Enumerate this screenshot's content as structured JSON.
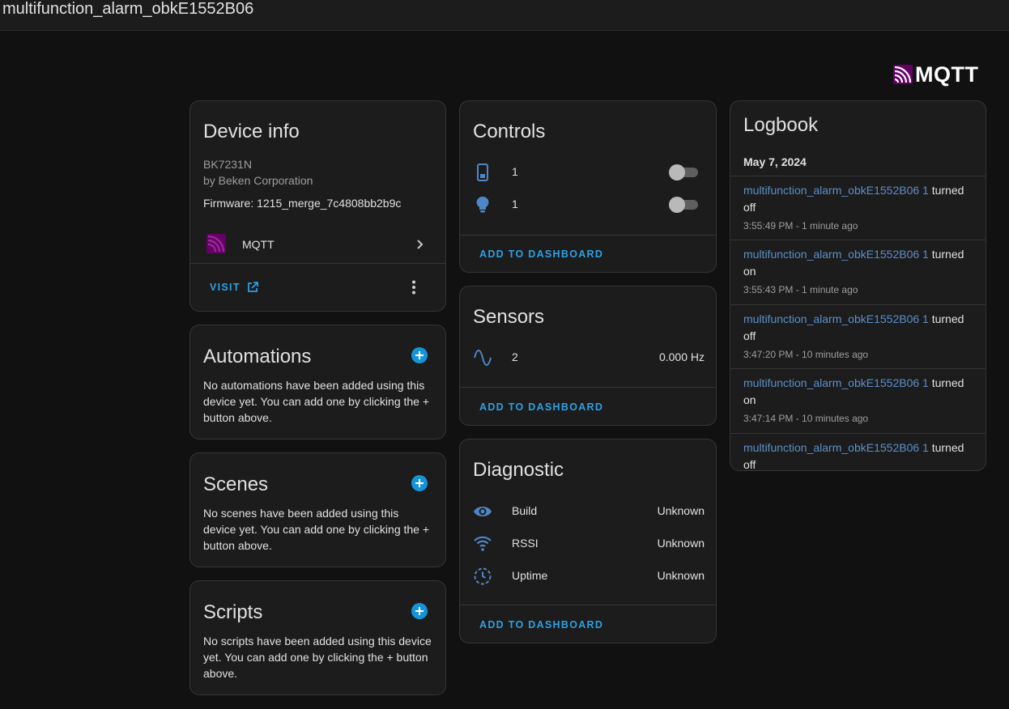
{
  "header": {
    "title": "multifunction_alarm_obkE1552B06"
  },
  "brand": {
    "name": "MQTT"
  },
  "device_info": {
    "title": "Device info",
    "model": "BK7231N",
    "manufacturer": "by Beken Corporation",
    "firmware": "Firmware: 1215_merge_7c4808bb2b9c",
    "integration": "MQTT",
    "visit_label": "VISIT"
  },
  "automations": {
    "title": "Automations",
    "empty_text": "No automations have been added using this device yet. You can add one by clicking the + button above."
  },
  "scenes": {
    "title": "Scenes",
    "empty_text": "No scenes have been added using this device yet. You can add one by clicking the + button above."
  },
  "scripts": {
    "title": "Scripts",
    "empty_text": "No scripts have been added using this device yet. You can add one by clicking the + button above."
  },
  "controls": {
    "title": "Controls",
    "items": [
      {
        "icon": "phone-icon",
        "name": "1",
        "state": "off"
      },
      {
        "icon": "lightbulb-icon",
        "name": "1",
        "state": "off"
      }
    ],
    "add_label": "ADD TO DASHBOARD"
  },
  "sensors": {
    "title": "Sensors",
    "items": [
      {
        "icon": "sine-wave-icon",
        "name": "2",
        "value": "0.000 Hz"
      }
    ],
    "add_label": "ADD TO DASHBOARD"
  },
  "diagnostic": {
    "title": "Diagnostic",
    "items": [
      {
        "icon": "eye-icon",
        "name": "Build",
        "value": "Unknown"
      },
      {
        "icon": "wifi-icon",
        "name": "RSSI",
        "value": "Unknown"
      },
      {
        "icon": "clock-icon",
        "name": "Uptime",
        "value": "Unknown"
      }
    ],
    "add_label": "ADD TO DASHBOARD"
  },
  "logbook": {
    "title": "Logbook",
    "date": "May 7, 2024",
    "entries": [
      {
        "entity": "multifunction_alarm_obkE1552B06 1",
        "action": "turned off",
        "time": "3:55:49 PM - 1 minute ago"
      },
      {
        "entity": "multifunction_alarm_obkE1552B06 1",
        "action": "turned on",
        "time": "3:55:43 PM - 1 minute ago"
      },
      {
        "entity": "multifunction_alarm_obkE1552B06 1",
        "action": "turned off",
        "time": "3:47:20 PM - 10 minutes ago"
      },
      {
        "entity": "multifunction_alarm_obkE1552B06 1",
        "action": "turned on",
        "time": "3:47:14 PM - 10 minutes ago"
      },
      {
        "entity": "multifunction_alarm_obkE1552B06 1",
        "action": "turned off",
        "time": ""
      }
    ]
  },
  "colors": {
    "background": "#111111",
    "card": "#1c1c1c",
    "accent": "#2fa0e3",
    "link": "#5b8fc9",
    "icon": "#4f86c6",
    "mqtt_brand": "#660066"
  }
}
